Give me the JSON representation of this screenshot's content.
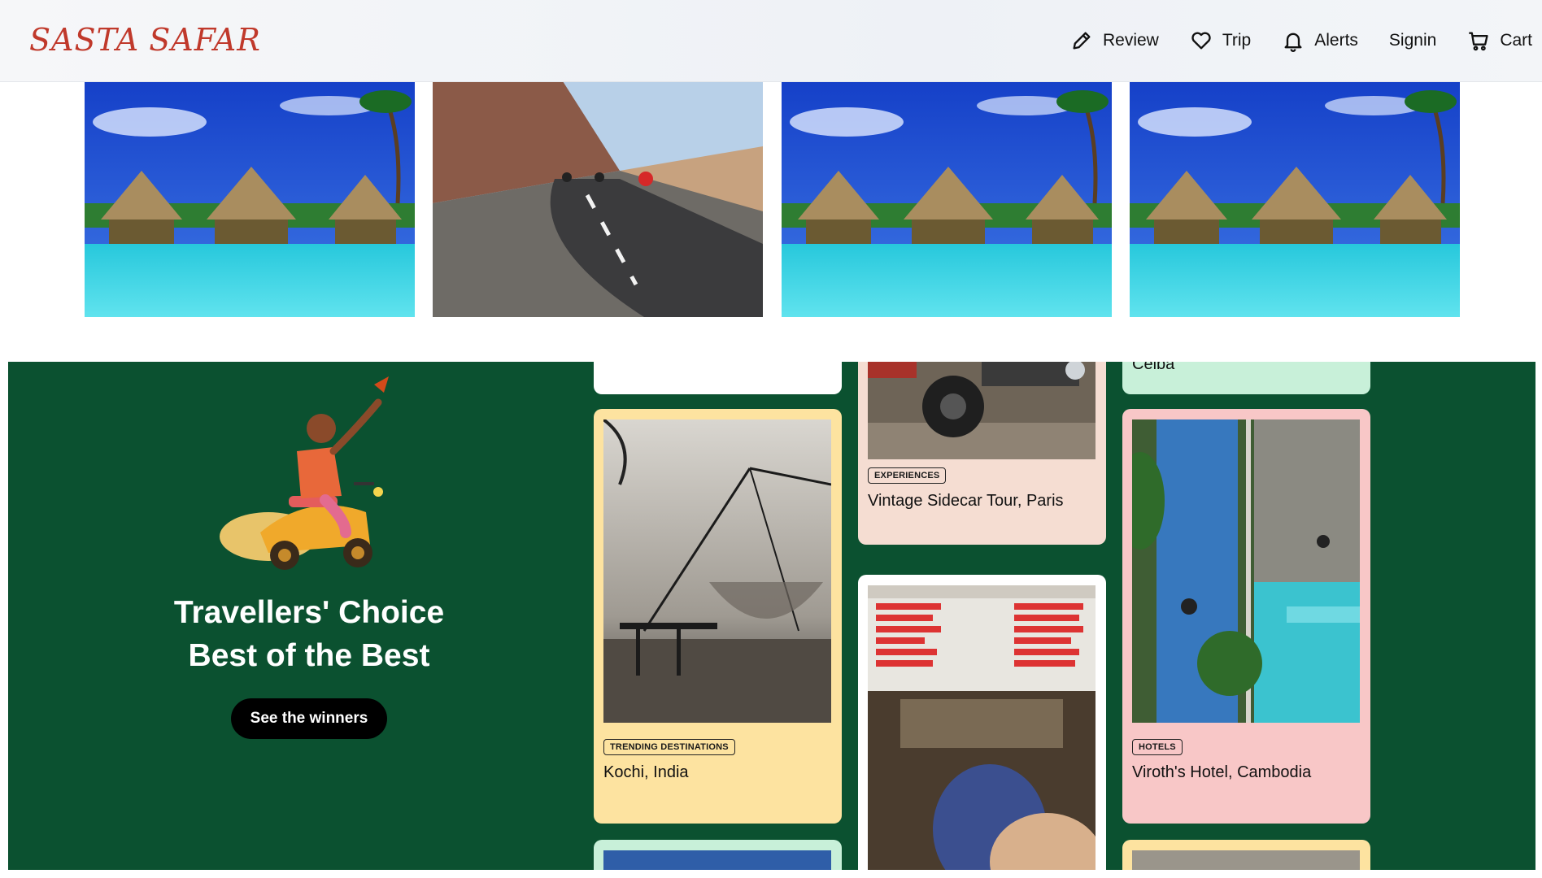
{
  "brand": {
    "word_left": "SASTA",
    "word_right": "SAFAR"
  },
  "nav": [
    {
      "label": "Review",
      "icon": "pencil-icon"
    },
    {
      "label": "Trip",
      "icon": "heart-icon"
    },
    {
      "label": "Alerts",
      "icon": "bell-icon"
    },
    {
      "label": "Signin",
      "icon": ""
    },
    {
      "label": "Cart",
      "icon": "cart-icon"
    }
  ],
  "strip": [
    {
      "scene": "overwater-bungalows"
    },
    {
      "scene": "motorbike-road"
    },
    {
      "scene": "overwater-bungalows"
    },
    {
      "scene": "overwater-bungalows"
    }
  ],
  "promo": {
    "title": "Travellers' Choice Best of the Best",
    "button": "See the winners"
  },
  "cards": [
    {
      "tag": "",
      "title": ""
    },
    {
      "tag": "TRENDING DESTINATIONS",
      "title": "Kochi, India"
    },
    {
      "tag": "EXPERIENCES",
      "title": "Vintage Sidecar Tour, Paris"
    },
    {
      "tag": "",
      "title": "Ceiba"
    },
    {
      "tag": "HOTELS",
      "title": "Viroth's Hotel, Cambodia"
    }
  ],
  "colors": {
    "green_section": "#0b5130",
    "card_yellow": "#fde3a0",
    "card_peach": "#f5ddd2",
    "card_mint": "#c8f0d9",
    "card_pink": "#f8c7c7",
    "button_bg": "#000000",
    "brand_red": "#c0392b"
  }
}
